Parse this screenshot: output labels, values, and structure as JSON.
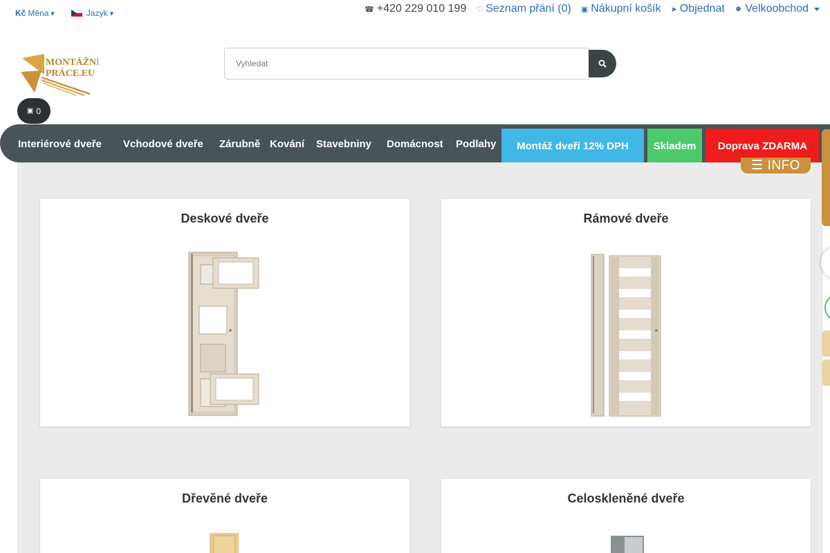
{
  "topbar": {
    "currency_symbol": "Kč",
    "currency_label": "Měna",
    "language_label": "Jazyk",
    "phone": "+420 229 010 199",
    "wishlist": "Seznam přání (0)",
    "cart": "Nákupní košík",
    "order": "Objednat",
    "wholesale": "Velkoobchod"
  },
  "logo": {
    "line1": "MONTÁŽNÍ",
    "line2": "PRÁCE.EU"
  },
  "search": {
    "placeholder": "Vyhledat"
  },
  "cart_pill": {
    "count": "0"
  },
  "nav": {
    "items": [
      "Interiérové dveře",
      "Vchodové dveře",
      "Zárubně",
      "Kování",
      "Stavebniny",
      "Domácnost",
      "Podlahy"
    ],
    "promo_mount": "Montáž dveří 12% DPH",
    "promo_stock": "Skladem",
    "promo_shipping": "Doprava ZDARMA",
    "info": "INFO"
  },
  "categories": [
    "Deskové dveře",
    "Rámové dveře",
    "Dřevěné dveře",
    "Celoskleněné dveře"
  ],
  "colors": {
    "nav_bg": "#485458",
    "accent_gold": "#c9913e",
    "promo_blue": "#3fb8e8",
    "promo_green": "#4cc96a",
    "promo_red": "#ee1c1c",
    "link_blue": "#2a6fb5"
  }
}
